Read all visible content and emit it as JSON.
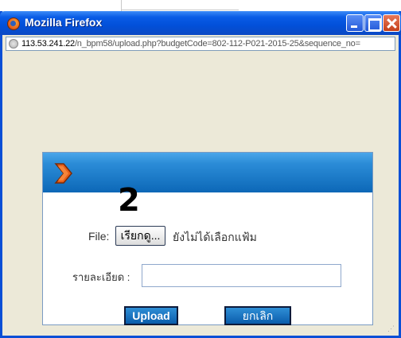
{
  "window": {
    "title": "Mozilla Firefox",
    "address_host": "113.53.241.22",
    "address_path": "/n_bpm58/upload.php?budgetCode=802-112-P021-2015-25&sequence_no="
  },
  "dialog": {
    "step_number": "2",
    "file_label": "File:",
    "browse_label": "เรียกดู...",
    "file_status": "ยังไม่ได้เลือกแฟ้ม",
    "detail_label": "รายละเอียด :",
    "detail_value": "",
    "upload_label": "Upload",
    "cancel_label": "ยกเลิก"
  },
  "colors": {
    "titlebar": "#0250d9",
    "panel_header": "#1c78c5",
    "chevron": "#e8601a",
    "button": "#0a5cab"
  },
  "icons": {
    "app": "firefox-icon",
    "site": "globe-icon",
    "header": "chevron-right-icon"
  }
}
